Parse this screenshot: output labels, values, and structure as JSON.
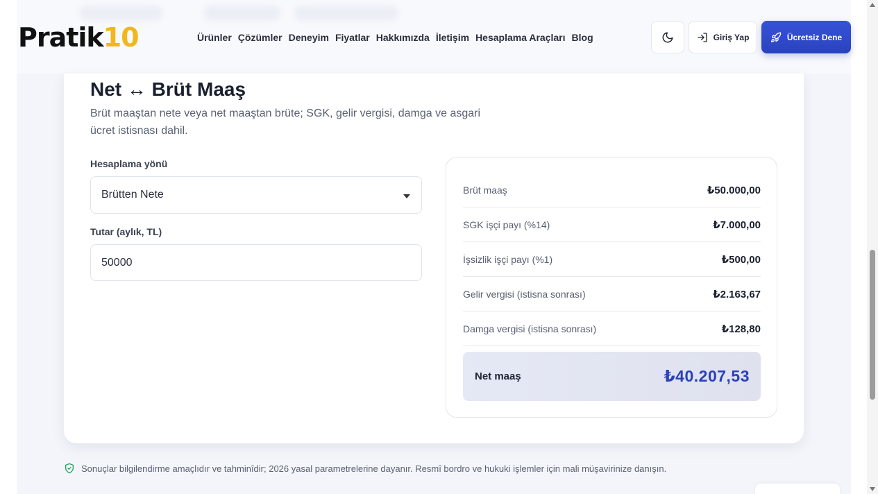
{
  "brand": {
    "logo_text": "Pratik",
    "logo_number": "10"
  },
  "nav": {
    "items": [
      {
        "label": "Ürünler"
      },
      {
        "label": "Çözümler"
      },
      {
        "label": "Deneyim"
      },
      {
        "label": "Fiyatlar"
      },
      {
        "label": "Hakkımızda"
      },
      {
        "label": "İletişim"
      },
      {
        "label": "Hesaplama Araçları"
      },
      {
        "label": "Blog"
      }
    ]
  },
  "header": {
    "theme_toggle_icon": "moon-icon",
    "login_label": "Giriş Yap",
    "login_icon": "login-arrow-icon",
    "cta_label": "Ücretsiz Dene",
    "cta_icon": "rocket-icon",
    "cta_color": "#2f4acb"
  },
  "calculator": {
    "title": "Net ↔ Brüt Maaş",
    "subtitle": "Brüt maaştan nete veya net maaştan brüte; SGK, gelir vergisi, damga ve asgari ücret istisnası dahil.",
    "direction_label": "Hesaplama yönü",
    "direction_value": "Brütten Nete",
    "amount_label": "Tutar (aylık, TL)",
    "amount_value": "50000"
  },
  "results": {
    "rows": [
      {
        "label": "Brüt maaş",
        "value": "₺50.000,00"
      },
      {
        "label": "SGK işçi payı (%14)",
        "value": "₺7.000,00"
      },
      {
        "label": "İşsizlik işçi payı (%1)",
        "value": "₺500,00"
      },
      {
        "label": "Gelir vergisi (istisna sonrası)",
        "value": "₺2.163,67"
      },
      {
        "label": "Damga vergisi (istisna sonrası)",
        "value": "₺128,80"
      }
    ],
    "net_label": "Net maaş",
    "net_value": "₺40.207,53",
    "net_color": "#2b41b8"
  },
  "disclaimer": {
    "icon": "shield-check-icon",
    "text": "Sonuçlar bilgilendirme amaçlıdır ve tahminîdir; 2026 yasal parametrelerine dayanır. Resmî bordro ve hukuki işlemler için mali müşavirinize danışın."
  }
}
